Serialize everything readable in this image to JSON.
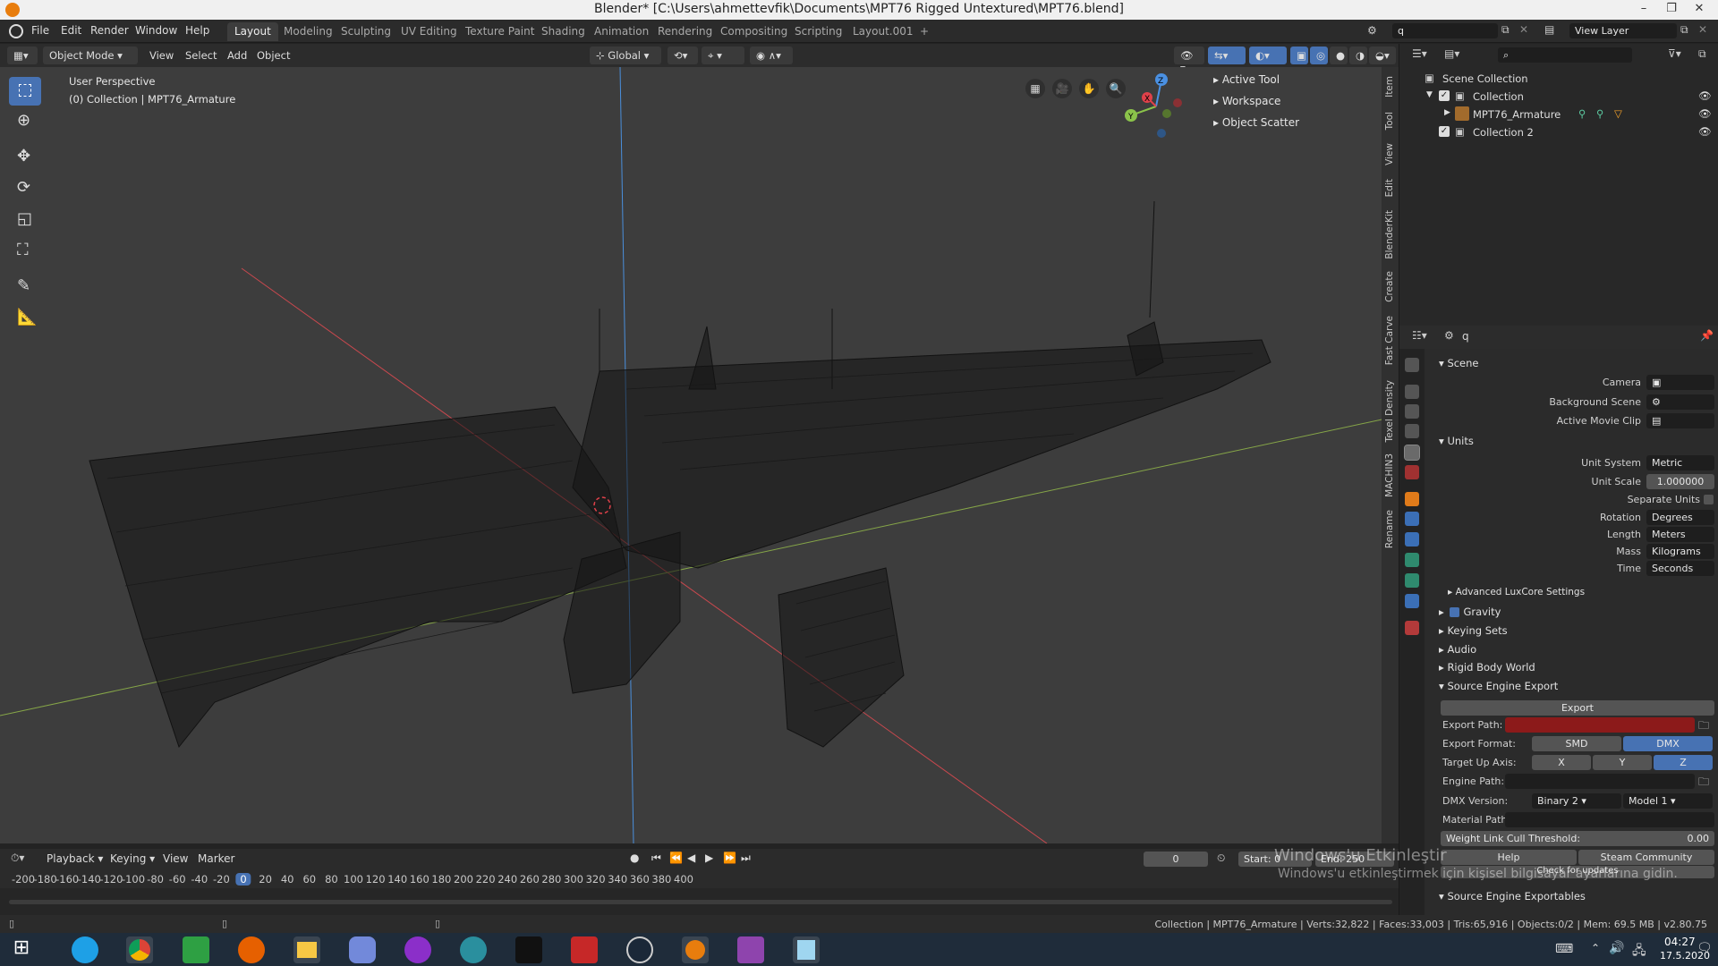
{
  "window": {
    "title": "Blender* [C:\\Users\\ahmettevfik\\Documents\\MPT76 Rigged Untextured\\MPT76.blend]",
    "controls": [
      "–",
      "❐",
      "✕"
    ]
  },
  "menu": [
    "File",
    "Edit",
    "Render",
    "Window",
    "Help"
  ],
  "workspaces": {
    "tabs": [
      "Layout",
      "Modeling",
      "Sculpting",
      "UV Editing",
      "Texture Paint",
      "Shading",
      "Animation",
      "Rendering",
      "Compositing",
      "Scripting",
      "Layout.001",
      "+"
    ],
    "active": "Layout"
  },
  "topbar_right": {
    "scene_field": "q",
    "view_layer": "View Layer"
  },
  "viewport_header": {
    "mode": "Object Mode",
    "menus": [
      "View",
      "Select",
      "Add",
      "Object"
    ],
    "orientation": "Global"
  },
  "viewport": {
    "perspective": "User Perspective",
    "collection_info": "(0) Collection | MPT76_Armature",
    "npanel": [
      "Active Tool",
      "Workspace",
      "Object Scatter"
    ],
    "side_tabs": [
      "Item",
      "Tool",
      "View",
      "Edit",
      "BlenderKit",
      "Create",
      "Fast Carve",
      "Texel Density",
      "MACHIN3",
      "Rename"
    ],
    "gizmo": {
      "x": "X",
      "y": "Y",
      "z": "Z"
    },
    "colors": {
      "x_axis": "#e0414a",
      "y_axis": "#8bc34a",
      "z_axis": "#4a90e2",
      "wire": "#111111",
      "bg": "#3d3d3d"
    }
  },
  "tools": [
    "select-box",
    "cursor",
    "move",
    "rotate",
    "scale",
    "transform",
    "annotate",
    "measure"
  ],
  "outliner": {
    "search": "",
    "root": "Scene Collection",
    "rows": [
      {
        "label": "Collection",
        "depth": 1
      },
      {
        "label": "MPT76_Armature",
        "depth": 2
      },
      {
        "label": "Collection 2",
        "depth": 1
      }
    ]
  },
  "properties": {
    "search": "q",
    "scene_section": "Scene",
    "camera_label": "Camera",
    "background_scene_label": "Background Scene",
    "active_movie_clip_label": "Active Movie Clip",
    "units_section": "Units",
    "unit_system_label": "Unit System",
    "unit_system": "Metric",
    "unit_scale_label": "Unit Scale",
    "unit_scale": "1.000000",
    "separate_units": "Separate Units",
    "rotation_label": "Rotation",
    "rotation": "Degrees",
    "length_label": "Length",
    "length": "Meters",
    "mass_label": "Mass",
    "mass": "Kilograms",
    "time_label": "Time",
    "time": "Seconds",
    "advanced": "Advanced LuxCore Settings",
    "gravity": "Gravity",
    "keying_sets": "Keying Sets",
    "audio": "Audio",
    "rigid_body_world": "Rigid Body World",
    "source_engine_export": "Source Engine Export",
    "export_button": "Export",
    "export_path_label": "Export Path:",
    "export_format_label": "Export Format:",
    "format_smd": "SMD",
    "format_dmx": "DMX",
    "target_up_label": "Target Up Axis:",
    "axis_x": "X",
    "axis_y": "Y",
    "axis_z": "Z",
    "engine_path_label": "Engine Path:",
    "dmx_version_label": "DMX Version:",
    "dmx_version": "Binary 2",
    "dmx_model": "Model 1",
    "material_path_label": "Material Path:",
    "weight_link_label": "Weight Link Cull Threshold:",
    "weight_link_value": "0.00",
    "help_button": "Help",
    "steam_button": "Steam Community",
    "check_updates": "Check for updates",
    "exportables": "Source Engine Exportables",
    "colors": {
      "export_path": "#8c1a1a",
      "selected": "#4772b3"
    }
  },
  "timeline": {
    "menus": [
      "Playback",
      "Keying",
      "View",
      "Marker"
    ],
    "current_frame": "0",
    "start_label": "Start:",
    "start": "0",
    "end_label": "End:",
    "end": "250",
    "ruler": [
      "-200",
      "-180",
      "-160",
      "-140",
      "-120",
      "-100",
      "-80",
      "-60",
      "-40",
      "-20",
      "0",
      "20",
      "40",
      "60",
      "80",
      "100",
      "120",
      "140",
      "160",
      "180",
      "200",
      "220",
      "240",
      "260",
      "280",
      "300",
      "320",
      "340",
      "360",
      "380",
      "400"
    ]
  },
  "status": {
    "text": "Collection | MPT76_Armature | Verts:32,822 | Faces:33,003 | Tris:65,916 | Objects:0/2 | Mem: 69.5 MB | v2.80.75"
  },
  "watermark": {
    "line1": "Windows'u Etkinleştir",
    "line2": "Windows'u etkinleştirmek için kişisel bilgisayar ayarlarına gidin."
  },
  "taskbar": {
    "icons": [
      "start-icon",
      "ie-icon",
      "chrome-icon",
      "store-icon",
      "firefox-icon",
      "explorer-icon",
      "discord-icon",
      "audio-icon",
      "app-icon",
      "acrobat-icon",
      "substance-icon",
      "steam-icon",
      "blender-icon",
      "winrar-icon",
      "notepad-icon"
    ],
    "time": "04:27",
    "date": "17.5.2020"
  }
}
